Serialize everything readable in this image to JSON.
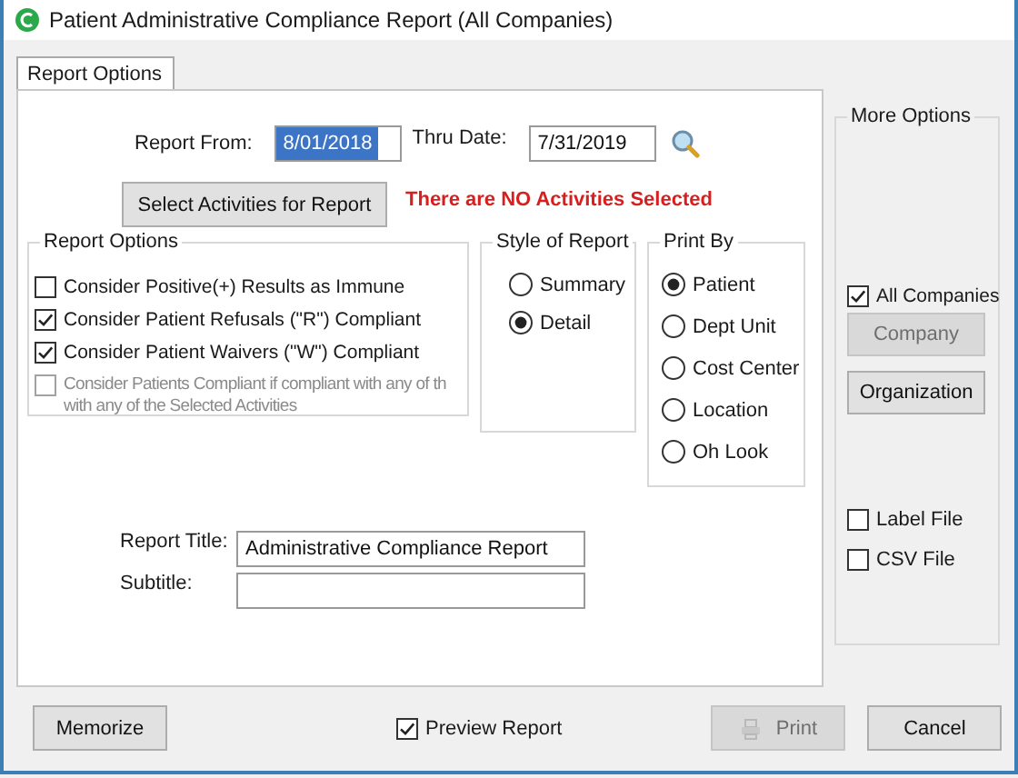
{
  "window": {
    "title": "Patient Administrative Compliance Report (All Companies)"
  },
  "tabs": [
    {
      "label": "Report Options",
      "selected": true
    }
  ],
  "date_range": {
    "from_label": "Report From:",
    "from_value": "8/01/2018",
    "thru_label": "Thru Date:",
    "thru_value": "7/31/2019"
  },
  "select_activities_button": "Select Activities for Report",
  "activities_warning": "There are NO Activities Selected",
  "report_options": {
    "title": "Report Options",
    "items": [
      {
        "label": "Consider Positive(+) Results as Immune",
        "checked": false,
        "disabled": false
      },
      {
        "label": "Consider Patient Refusals (\"R\") Compliant",
        "checked": true,
        "disabled": false
      },
      {
        "label": "Consider Patient Waivers (\"W\") Compliant",
        "checked": true,
        "disabled": false
      },
      {
        "label": "Consider Patients Compliant if compliant with any of th\nwith any of the Selected Activities",
        "checked": false,
        "disabled": true
      }
    ]
  },
  "style_of_report": {
    "title": "Style of Report",
    "options": [
      {
        "label": "Summary",
        "selected": false
      },
      {
        "label": "Detail",
        "selected": true
      }
    ]
  },
  "print_by": {
    "title": "Print By",
    "options": [
      {
        "label": "Patient",
        "selected": true
      },
      {
        "label": "Dept Unit",
        "selected": false
      },
      {
        "label": "Cost Center",
        "selected": false
      },
      {
        "label": "Location",
        "selected": false
      },
      {
        "label": "Oh Look",
        "selected": false
      }
    ]
  },
  "report_title": {
    "label": "Report Title:",
    "value": "Administrative Compliance Report"
  },
  "subtitle": {
    "label": "Subtitle:"
  },
  "more_options": {
    "title": "More Options",
    "all_companies": {
      "label": "All Companies",
      "checked": true
    },
    "buttons": [
      {
        "label": "Company",
        "disabled": true
      },
      {
        "label": "Organization",
        "disabled": false
      }
    ],
    "files": [
      {
        "label": "Label File",
        "checked": false
      },
      {
        "label": "CSV File",
        "checked": false
      }
    ]
  },
  "footer": {
    "memorize": "Memorize",
    "preview": {
      "label": "Preview Report",
      "checked": true
    },
    "print": {
      "label": "Print",
      "disabled": true
    },
    "cancel": "Cancel"
  }
}
